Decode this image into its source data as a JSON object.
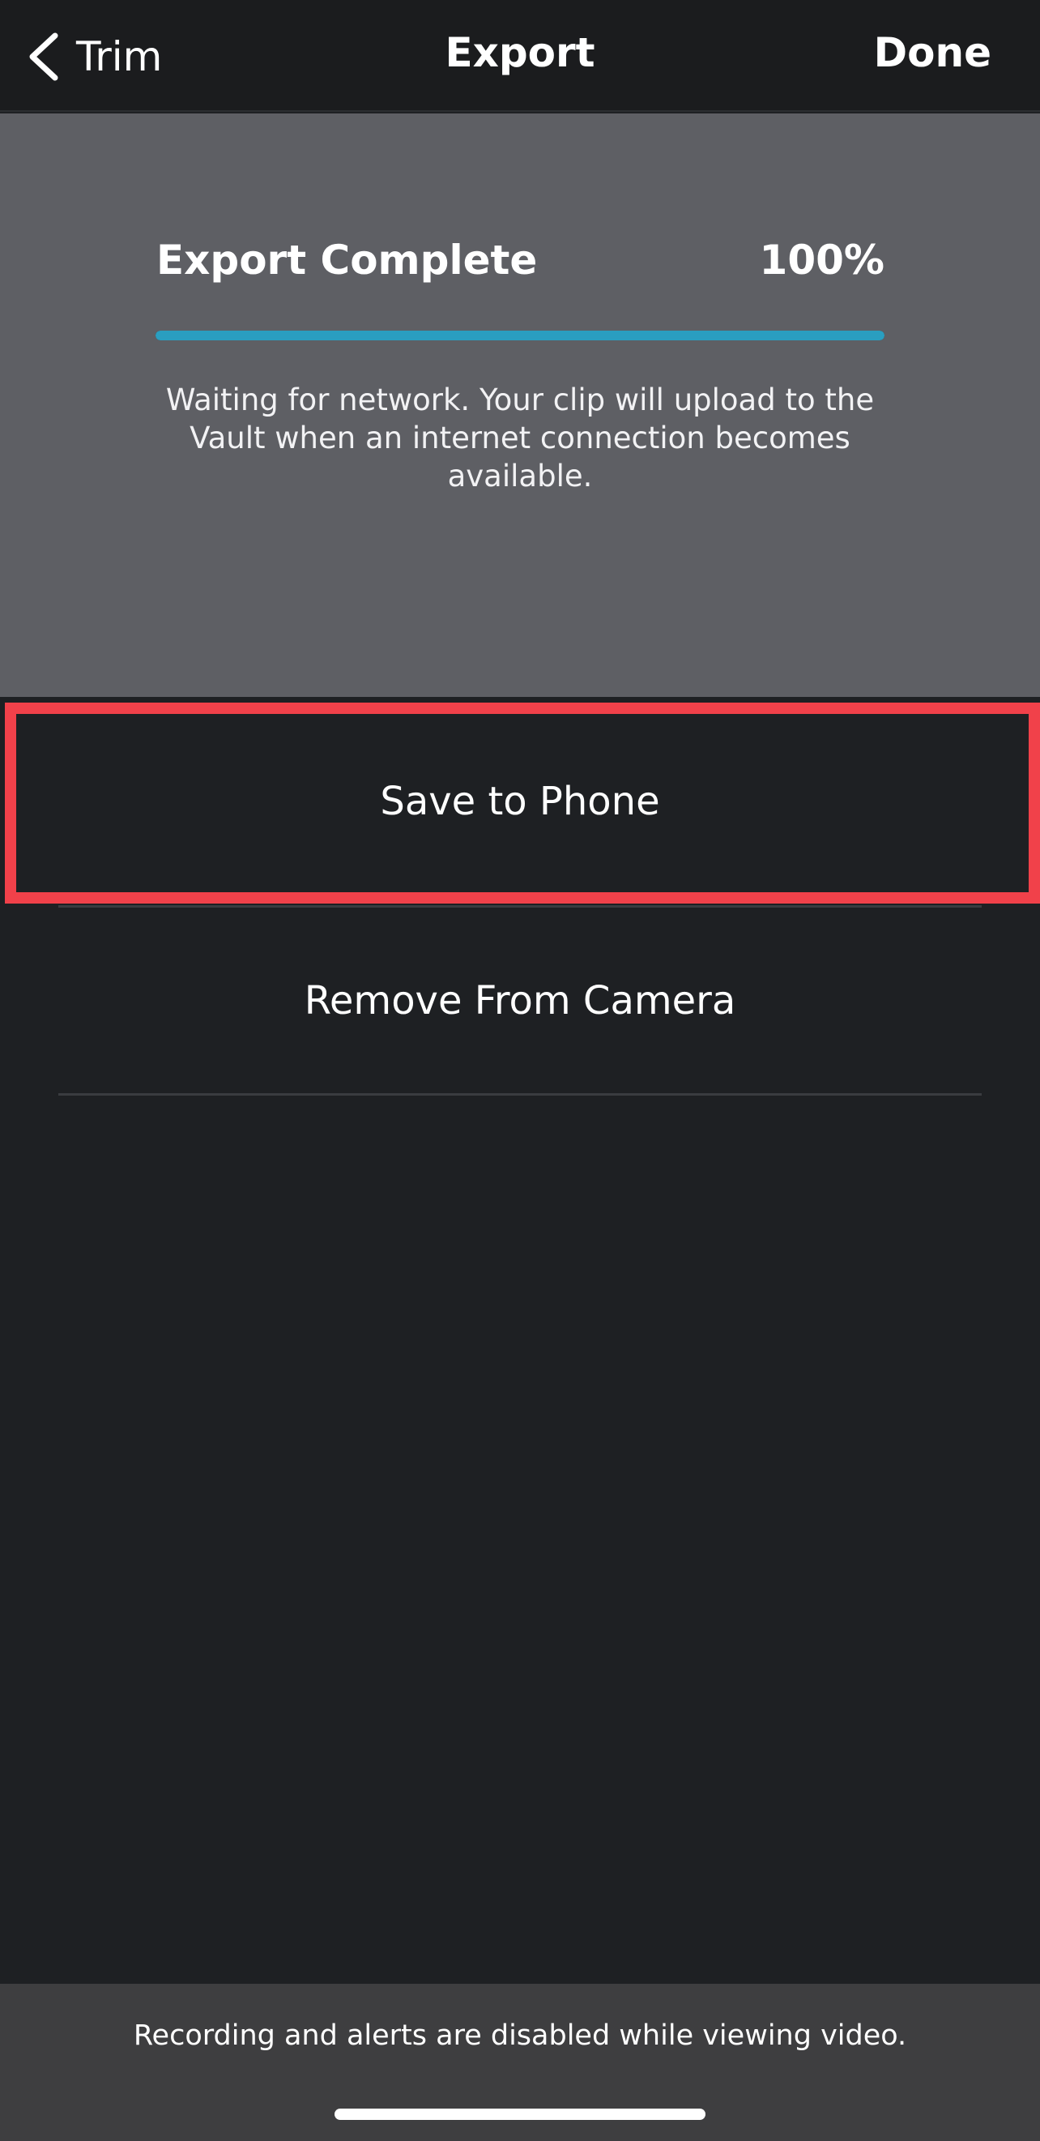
{
  "navbar": {
    "back_label": "Trim",
    "title": "Export",
    "done_label": "Done",
    "back_icon": "chevron-left-icon"
  },
  "export_status": {
    "title": "Export Complete",
    "percent_label": "100%",
    "progress": 1.0,
    "message": "Waiting for network. Your clip will upload to the Vault when an internet connection becomes available."
  },
  "actions": {
    "save_label": "Save to Phone",
    "remove_label": "Remove From Camera"
  },
  "footer": {
    "notice": "Recording and alerts are disabled while viewing video."
  },
  "colors": {
    "progress_fill": "#2a9ec0",
    "highlight": "#f1414a",
    "panel_bg": "#5e5f64",
    "page_bg": "#1e2023"
  }
}
